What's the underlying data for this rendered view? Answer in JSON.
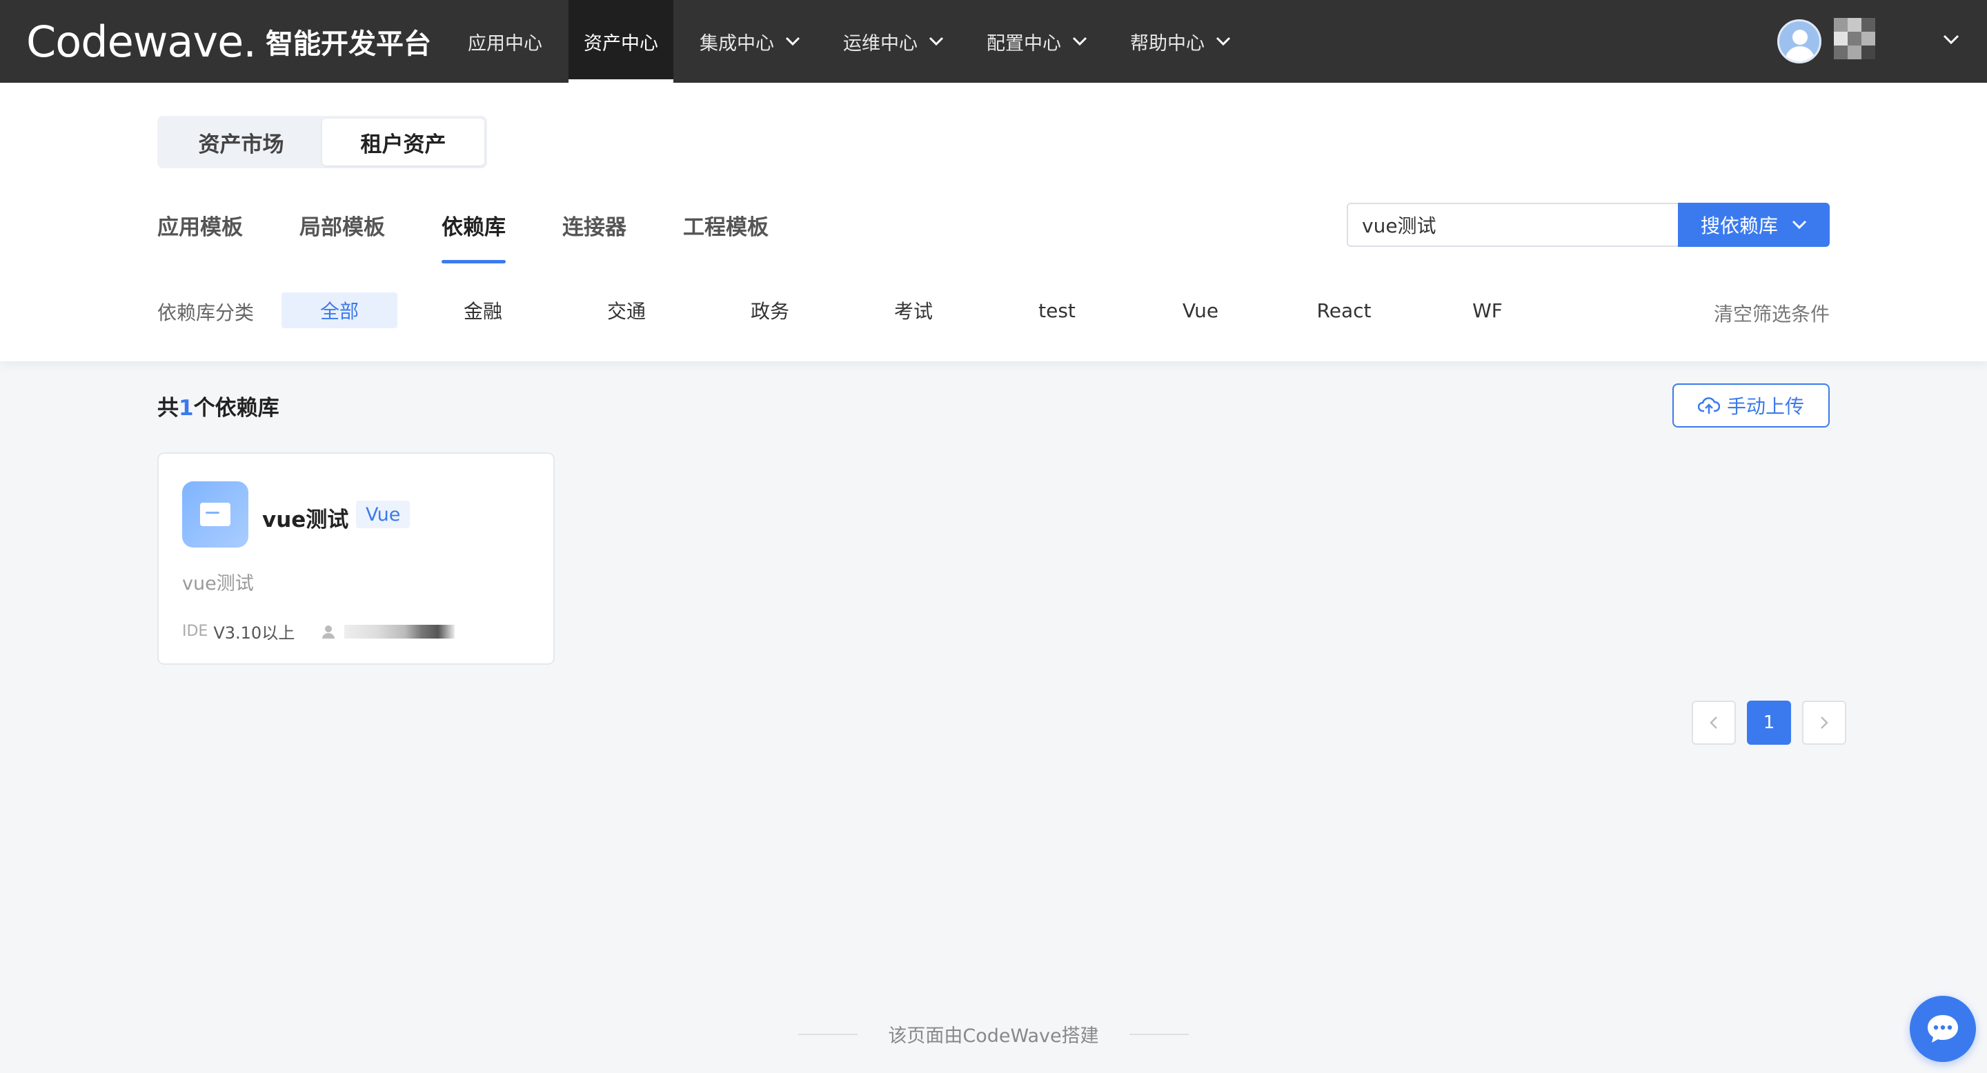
{
  "brand": {
    "logo": "Codewave.",
    "subtitle": "智能开发平台"
  },
  "nav": {
    "items": [
      {
        "label": "应用中心",
        "has_dropdown": false,
        "active": false
      },
      {
        "label": "资产中心",
        "has_dropdown": false,
        "active": true
      },
      {
        "label": "集成中心",
        "has_dropdown": true,
        "active": false
      },
      {
        "label": "运维中心",
        "has_dropdown": true,
        "active": false
      },
      {
        "label": "配置中心",
        "has_dropdown": true,
        "active": false
      },
      {
        "label": "帮助中心",
        "has_dropdown": true,
        "active": false
      }
    ]
  },
  "user": {
    "avatar_icon": "user-avatar",
    "name_obscured": true
  },
  "segment": {
    "options": [
      "资产市场",
      "租户资产"
    ],
    "selected": "租户资产"
  },
  "tabs": {
    "items": [
      "应用模板",
      "局部模板",
      "依赖库",
      "连接器",
      "工程模板"
    ],
    "active": "依赖库"
  },
  "search": {
    "value": "vue测试",
    "button_label": "搜依赖库"
  },
  "filter": {
    "label": "依赖库分类",
    "options": [
      "全部",
      "金融",
      "交通",
      "政务",
      "考试",
      "test",
      "Vue",
      "React",
      "WF"
    ],
    "active": "全部",
    "clear_label": "清空筛选条件"
  },
  "results": {
    "prefix": "共",
    "count": "1",
    "suffix": "个依赖库"
  },
  "upload": {
    "label": "手动上传",
    "icon": "cloud-upload-icon"
  },
  "cards": [
    {
      "title": "vue测试",
      "tag": "Vue",
      "description": "vue测试",
      "ide_label": "IDE",
      "version": "V3.10以上",
      "icon": "folder-icon"
    }
  ],
  "pagination": {
    "current": "1"
  },
  "footer": {
    "text": "该页面由CodeWave搭建"
  },
  "colors": {
    "accent": "#3b7aee",
    "topbar": "#333333",
    "page_bg": "#f5f6f8"
  }
}
